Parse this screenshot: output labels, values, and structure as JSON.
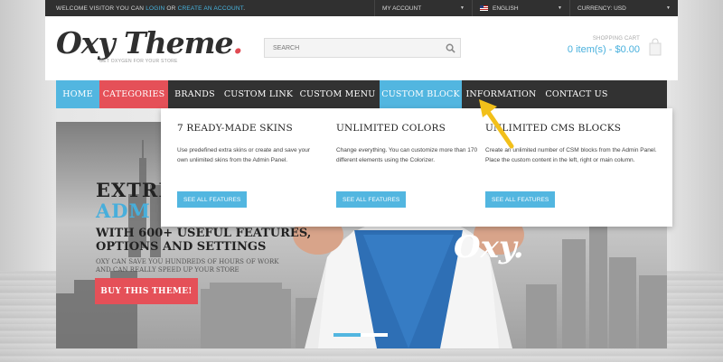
{
  "topbar": {
    "welcome_text": "WELCOME VISITOR YOU CAN ",
    "login": "LOGIN",
    "or": " OR ",
    "create": "CREATE AN ACCOUNT",
    "period": ".",
    "account": "MY ACCOUNT",
    "language": "ENGLISH",
    "currency": "CURRENCY: USD"
  },
  "header": {
    "logo_text": "Oxy Theme",
    "logo_dot": ".",
    "tagline": "GET OXYGEN FOR YOUR STORE",
    "search_placeholder": "SEARCH",
    "cart_label": "SHOPPING CART",
    "cart_value": "0 item(s) - $0.00"
  },
  "nav": {
    "home": "HOME",
    "categories": "CATEGORIES",
    "brands": "BRANDS",
    "custom_link": "CUSTOM LINK",
    "custom_menu": "CUSTOM MENU",
    "custom_block": "CUSTOM BLOCK",
    "information": "INFORMATION",
    "contact": "CONTACT US"
  },
  "dropdown": {
    "columns": [
      {
        "title": "7 READY-MADE SKINS",
        "text": "Use predefined extra skins or create and save your own unlimited skins from the Admin Panel.",
        "button": "SEE ALL FEATURES"
      },
      {
        "title": "UNLIMITED COLORS",
        "text": "Change everything. You can customize more than 170 different elements using the Colorizer.",
        "button": "SEE ALL FEATURES"
      },
      {
        "title": "UNLIMITED CMS BLOCKS",
        "text": "Create an unlimited number of CSM blocks from the Admin Panel. Place the custom content in the left, right or main column.",
        "button": "SEE ALL FEATURES"
      }
    ]
  },
  "hero": {
    "title_line1": "EXTRE",
    "title_line2": "ADM",
    "subtitle1": "WITH 600+ USEFUL FEATURES,",
    "subtitle2": "OPTIONS AND SETTINGS",
    "small_text": "OXY CAN SAVE YOU HUNDREDS OF HOURS OF WORK AND CAN REALLY SPEED UP YOUR STORE",
    "button": "BUY THIS THEME!",
    "chest_logo": "Oxy.",
    "slider_active": 1,
    "slider_count": 2
  },
  "colors": {
    "accent_blue": "#52b6e0",
    "accent_red": "#e55058",
    "nav_dark": "#323232",
    "arrow_yellow": "#f2c01a"
  }
}
